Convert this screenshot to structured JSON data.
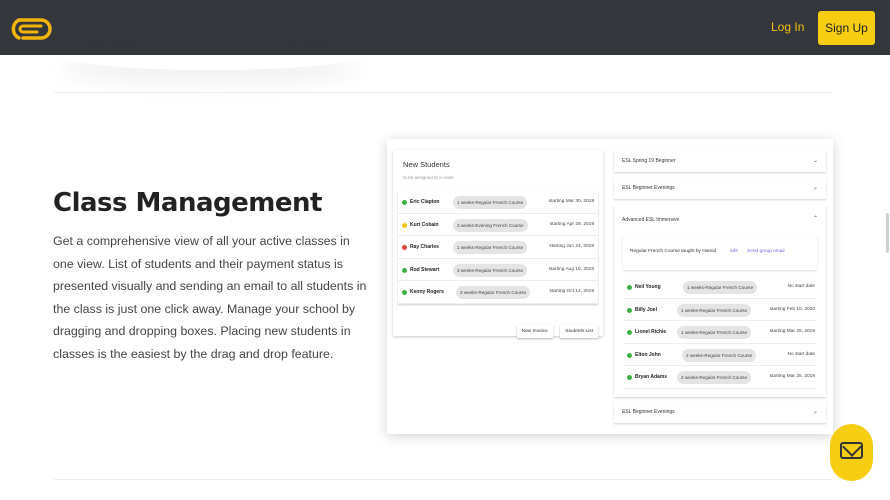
{
  "header": {
    "login_label": "Log In",
    "signup_label": "Sign Up",
    "brand_color": "#f7cd12",
    "bg_color": "#33363b"
  },
  "section": {
    "title": "Class Management",
    "description": "Get a comprehensive view of all your active classes in one view. List of students and their payment status is presented visually and sending an email to all students in the class is just one click away. Manage your school by dragging and dropping boxes. Placing new students in classes is the easiest by the drag and drop feature."
  },
  "new_students": {
    "title": "New Students",
    "subtitle": "to be assigned to a class",
    "rows": [
      {
        "name": "Eric Clapton",
        "course": "1 weeks-Regular French Course",
        "date": "starting Mar 30, 2019",
        "status": "green"
      },
      {
        "name": "Kurt Cobain",
        "course": "3 weeks-Evening French Course",
        "date": "starting Apr 29, 2019",
        "status": "yellow"
      },
      {
        "name": "Ray Charles",
        "course": "1 weeks-Regular French Course",
        "date": "starting Jun 24, 2019",
        "status": "red"
      },
      {
        "name": "Rod Stewart",
        "course": "3 weeks-Regular French Course",
        "date": "starting Aug 19, 2019",
        "status": "green"
      },
      {
        "name": "Kenny Rogers",
        "course": "3 weeks-Regular French Course",
        "date": "starting Oct 14, 2019",
        "status": "green"
      }
    ],
    "new_invoice_label": "New Invoice",
    "students_list_label": "Students List"
  },
  "classes": {
    "accordion": [
      {
        "label": "ESL Spring 19 Beginner",
        "expanded": false
      },
      {
        "label": "ESL Beginner Evenings",
        "expanded": false
      },
      {
        "label": "Advanced ESL Immersive",
        "expanded": true
      },
      {
        "label": "ESL Beginner Evenings",
        "expanded": false
      }
    ],
    "teacher_text": "Regular French Course taught by Hamid",
    "edit_label": "edit",
    "email_label": "Send group email",
    "rows": [
      {
        "name": "Neil Young",
        "course": "1 weeks-Regular French Course",
        "date": "No start date"
      },
      {
        "name": "Billy Joel",
        "course": "1 weeks-Regular French Course",
        "date": "starting Feb 10, 2020"
      },
      {
        "name": "Lionel Richie",
        "course": "1 weeks-Regular French Course",
        "date": "starting Mar 25, 2019"
      },
      {
        "name": "Elton John",
        "course": "2 weeks-Regular French Course",
        "date": "No start date"
      },
      {
        "name": "Bryan Adams",
        "course": "2 weeks-Regular French Course",
        "date": "starting Mar 25, 2019"
      }
    ]
  },
  "status_colors": {
    "green": "#3cb043",
    "yellow": "#f2c200",
    "red": "#e0463a"
  },
  "icons": {
    "logo": "brand-logo-icon",
    "chat": "mail-icon"
  }
}
